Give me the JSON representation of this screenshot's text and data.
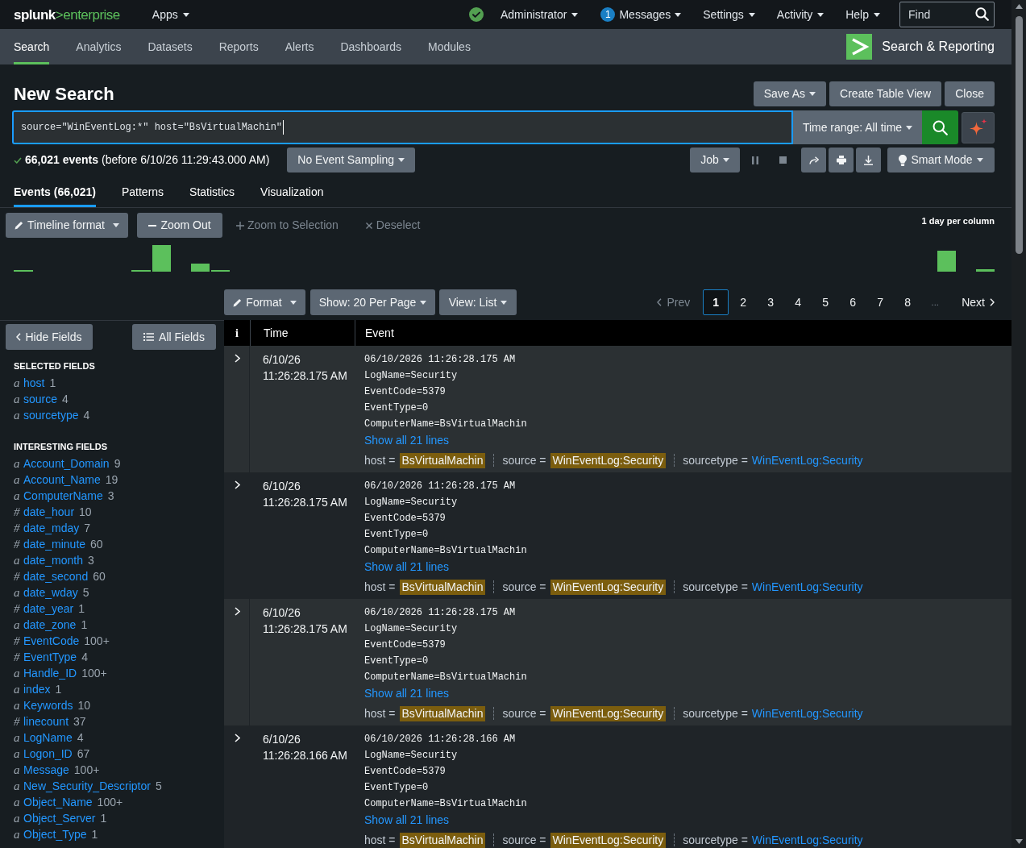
{
  "top_bar": {
    "logo": {
      "name": "splunk",
      "product": ">enterprise"
    },
    "apps": "Apps",
    "user": "Administrator",
    "messages": {
      "count": "1",
      "label": "Messages"
    },
    "menus": [
      "Settings",
      "Activity",
      "Help"
    ],
    "find": {
      "placeholder": "Find"
    }
  },
  "app_bar": {
    "tabs": [
      {
        "label": "Search",
        "selected": true
      },
      {
        "label": "Analytics",
        "selected": false
      },
      {
        "label": "Datasets",
        "selected": false
      },
      {
        "label": "Reports",
        "selected": false
      },
      {
        "label": "Alerts",
        "selected": false
      },
      {
        "label": "Dashboards",
        "selected": false
      },
      {
        "label": "Modules",
        "selected": false
      }
    ],
    "app_name": "Search & Reporting"
  },
  "search": {
    "title": "New Search",
    "actions": [
      {
        "label": "Save As",
        "dropdown": true
      },
      {
        "label": "Create Table View",
        "dropdown": false
      },
      {
        "label": "Close",
        "dropdown": false
      }
    ],
    "query": "source=\"WinEventLog:*\" host=\"BsVirtualMachin\"",
    "time_range": "Time range: All time"
  },
  "job_bar": {
    "summary": "**66,021 events** (before 6/10/26 11:29:43.000 AM)",
    "sampling": "No Event Sampling",
    "job": "Job",
    "mode": "Smart Mode"
  },
  "result_tabs": [
    {
      "label": "Events (66,021)",
      "selected": true
    },
    {
      "label": "Patterns",
      "selected": false
    },
    {
      "label": "Statistics",
      "selected": false
    },
    {
      "label": "Visualization",
      "selected": false
    }
  ],
  "timeline": {
    "format": "Timeline format",
    "zoom_out": "Zoom Out",
    "zoom_to_selection": {
      "label": "Zoom to Selection",
      "disabled": true
    },
    "deselect": {
      "label": "Deselect",
      "disabled": true
    },
    "scale": "1 day per column"
  },
  "results_toolbar": {
    "format": "Format",
    "per_page": "Show: 20 Per Page",
    "view": "View: List"
  },
  "pagination": {
    "prev": {
      "label": "Prev",
      "disabled": true
    },
    "pages": [
      {
        "label": "1",
        "selected": true
      },
      {
        "label": "2",
        "selected": false
      },
      {
        "label": "3",
        "selected": false
      },
      {
        "label": "4",
        "selected": false
      },
      {
        "label": "5",
        "selected": false
      },
      {
        "label": "6",
        "selected": false
      },
      {
        "label": "7",
        "selected": false
      },
      {
        "label": "8",
        "selected": false
      }
    ],
    "ellipsis": "...",
    "next": "Next"
  },
  "fields_sidebar": {
    "hide_fields": "Hide Fields",
    "all_fields": "All Fields",
    "selected_heading": "SELECTED FIELDS",
    "selected_fields": [
      {
        "type": "a",
        "name": "host",
        "count": "1"
      },
      {
        "type": "a",
        "name": "source",
        "count": "4"
      },
      {
        "type": "a",
        "name": "sourcetype",
        "count": "4"
      }
    ],
    "interesting_heading": "INTERESTING FIELDS",
    "interesting_fields": [
      {
        "type": "a",
        "name": "Account_Domain",
        "count": "9"
      },
      {
        "type": "a",
        "name": "Account_Name",
        "count": "19"
      },
      {
        "type": "a",
        "name": "ComputerName",
        "count": "3"
      },
      {
        "type": "#",
        "name": "date_hour",
        "count": "10"
      },
      {
        "type": "#",
        "name": "date_mday",
        "count": "7"
      },
      {
        "type": "#",
        "name": "date_minute",
        "count": "60"
      },
      {
        "type": "a",
        "name": "date_month",
        "count": "3"
      },
      {
        "type": "#",
        "name": "date_second",
        "count": "60"
      },
      {
        "type": "a",
        "name": "date_wday",
        "count": "5"
      },
      {
        "type": "#",
        "name": "date_year",
        "count": "1"
      },
      {
        "type": "a",
        "name": "date_zone",
        "count": "1"
      },
      {
        "type": "#",
        "name": "EventCode",
        "count": "100+"
      },
      {
        "type": "#",
        "name": "EventType",
        "count": "4"
      },
      {
        "type": "a",
        "name": "Handle_ID",
        "count": "100+"
      },
      {
        "type": "a",
        "name": "index",
        "count": "1"
      },
      {
        "type": "a",
        "name": "Keywords",
        "count": "10"
      },
      {
        "type": "#",
        "name": "linecount",
        "count": "37"
      },
      {
        "type": "a",
        "name": "LogName",
        "count": "4"
      },
      {
        "type": "a",
        "name": "Logon_ID",
        "count": "67"
      },
      {
        "type": "a",
        "name": "Message",
        "count": "100+"
      },
      {
        "type": "a",
        "name": "New_Security_Descriptor",
        "count": "5"
      },
      {
        "type": "a",
        "name": "Object_Name",
        "count": "100+"
      },
      {
        "type": "a",
        "name": "Object_Server",
        "count": "1"
      },
      {
        "type": "a",
        "name": "Object_Type",
        "count": "1"
      }
    ]
  },
  "events_table": {
    "columns": [
      "i",
      "Time",
      "Event"
    ],
    "rows": [
      {
        "date": "6/10/26",
        "time": "11:26:28.175 AM",
        "lines": [
          "06/10/2026 11:26:28.175 AM",
          "LogName=Security",
          "EventCode=5379",
          "EventType=0",
          "ComputerName=BsVirtualMachin"
        ],
        "show_all": "Show all 21 lines",
        "fields": [
          {
            "label": "host =",
            "value": "BsVirtualMachin",
            "highlighted": true
          },
          {
            "label": "source =",
            "value": "WinEventLog:Security",
            "highlighted": true
          },
          {
            "label": "sourcetype =",
            "value": "WinEventLog:Security",
            "highlighted": false
          }
        ]
      },
      {
        "date": "6/10/26",
        "time": "11:26:28.175 AM",
        "lines": [
          "06/10/2026 11:26:28.175 AM",
          "LogName=Security",
          "EventCode=5379",
          "EventType=0",
          "ComputerName=BsVirtualMachin"
        ],
        "show_all": "Show all 21 lines",
        "fields": [
          {
            "label": "host =",
            "value": "BsVirtualMachin",
            "highlighted": true
          },
          {
            "label": "source =",
            "value": "WinEventLog:Security",
            "highlighted": true
          },
          {
            "label": "sourcetype =",
            "value": "WinEventLog:Security",
            "highlighted": false
          }
        ]
      },
      {
        "date": "6/10/26",
        "time": "11:26:28.175 AM",
        "lines": [
          "06/10/2026 11:26:28.175 AM",
          "LogName=Security",
          "EventCode=5379",
          "EventType=0",
          "ComputerName=BsVirtualMachin"
        ],
        "show_all": "Show all 21 lines",
        "fields": [
          {
            "label": "host =",
            "value": "BsVirtualMachin",
            "highlighted": true
          },
          {
            "label": "source =",
            "value": "WinEventLog:Security",
            "highlighted": true
          },
          {
            "label": "sourcetype =",
            "value": "WinEventLog:Security",
            "highlighted": false
          }
        ]
      },
      {
        "date": "6/10/26",
        "time": "11:26:28.166 AM",
        "lines": [
          "06/10/2026 11:26:28.166 AM",
          "LogName=Security",
          "EventCode=5379",
          "EventType=0",
          "ComputerName=BsVirtualMachin"
        ],
        "show_all": "Show all 21 lines",
        "fields": [
          {
            "label": "host =",
            "value": "BsVirtualMachin",
            "highlighted": true
          },
          {
            "label": "source =",
            "value": "WinEventLog:Security",
            "highlighted": true
          },
          {
            "label": "sourcetype =",
            "value": "WinEventLog:Security",
            "highlighted": false
          }
        ]
      }
    ]
  }
}
